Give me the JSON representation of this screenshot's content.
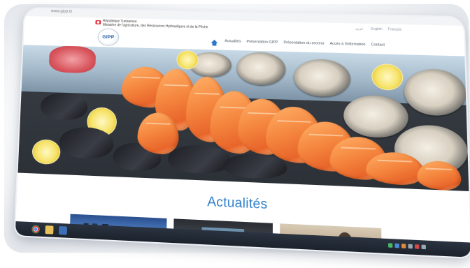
{
  "browser": {
    "url": "www.gipp.tn"
  },
  "header": {
    "republic": "République Tunisienne",
    "ministry": "Ministère de l'agriculture, des Ressources Hydrauliques et de la Pêche",
    "logo_text": "GIPP",
    "languages": [
      "عربي",
      "English",
      "Français"
    ]
  },
  "nav": {
    "items": [
      "Actualités",
      "Présentation GIPP",
      "Présentation du secteur",
      "Accès à l'information",
      "Contact"
    ],
    "active_index": 0
  },
  "news": {
    "title": "Actualités"
  },
  "colors": {
    "accent": "#2f7ec9",
    "flag": "#e4222f"
  }
}
